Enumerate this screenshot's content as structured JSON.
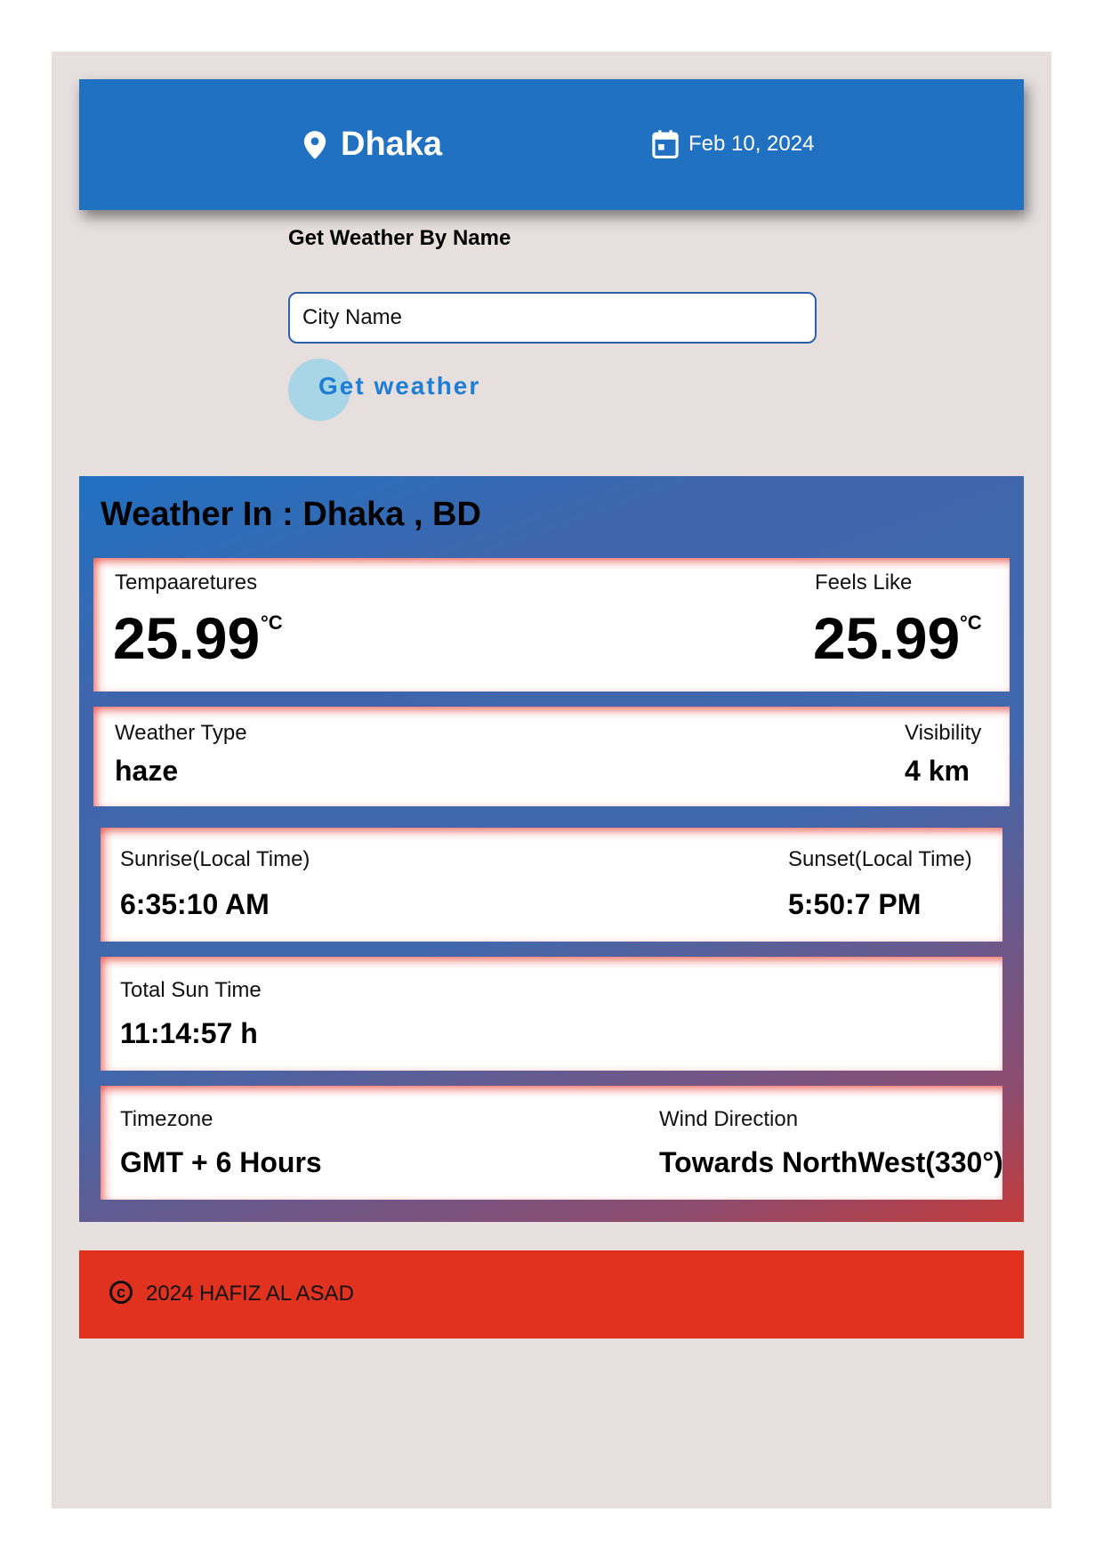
{
  "header": {
    "location_icon": "map-pin-icon",
    "city": "Dhaka",
    "calendar_icon": "calendar-icon",
    "date": "Feb 10, 2024",
    "background_color": "#2071c2"
  },
  "search": {
    "title": "Get Weather By Name",
    "placeholder": "City Name",
    "button_label": "Get weather"
  },
  "weather": {
    "title": "Weather In : Dhaka , BD",
    "temperature_label": "Tempaaretures",
    "temperature_value": "25.99",
    "temperature_unit": "°C",
    "feels_like_label": "Feels Like",
    "feels_like_value": "25.99",
    "feels_like_unit": "°C",
    "weather_type_label": "Weather Type",
    "weather_type_value": "haze",
    "visibility_label": "Visibility",
    "visibility_value": "4 km",
    "sunrise_label": "Sunrise(Local Time)",
    "sunrise_value": "6:35:10 AM",
    "sunset_label": "Sunset(Local Time)",
    "sunset_value": "5:50:7 PM",
    "total_sun_label": "Total Sun Time",
    "total_sun_value": "11:14:57 h",
    "timezone_label": "Timezone",
    "timezone_value": "GMT + 6 Hours",
    "wind_label": "Wind Direction",
    "wind_value": "Towards NorthWest(330°)"
  },
  "footer": {
    "copyright_icon": "copyright-icon",
    "text": "2024 HAFIZ AL ASAD",
    "background_color": "#e0321f"
  }
}
